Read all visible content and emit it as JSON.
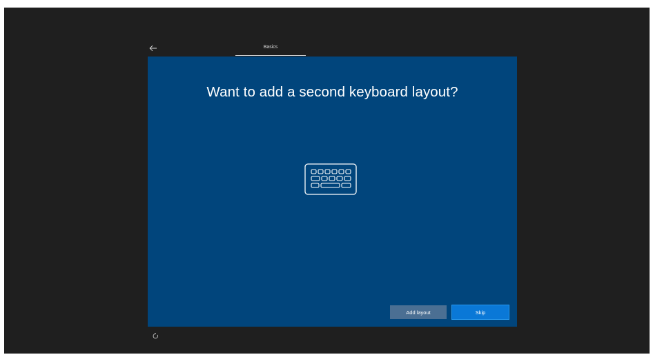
{
  "header": {
    "back_icon": "back-arrow-icon",
    "tab_label": "Basics"
  },
  "main": {
    "title": "Want to add a second keyboard layout?",
    "illustration_icon": "keyboard-icon"
  },
  "actions": {
    "add_layout_label": "Add layout",
    "skip_label": "Skip"
  },
  "footer": {
    "accessibility_icon": "ease-of-access-icon"
  },
  "colors": {
    "screen_background": "#1f1f1f",
    "panel_background": "#01457c",
    "secondary_button": "#4b6f93",
    "primary_button": "#0a78d7",
    "text": "#ffffff"
  }
}
